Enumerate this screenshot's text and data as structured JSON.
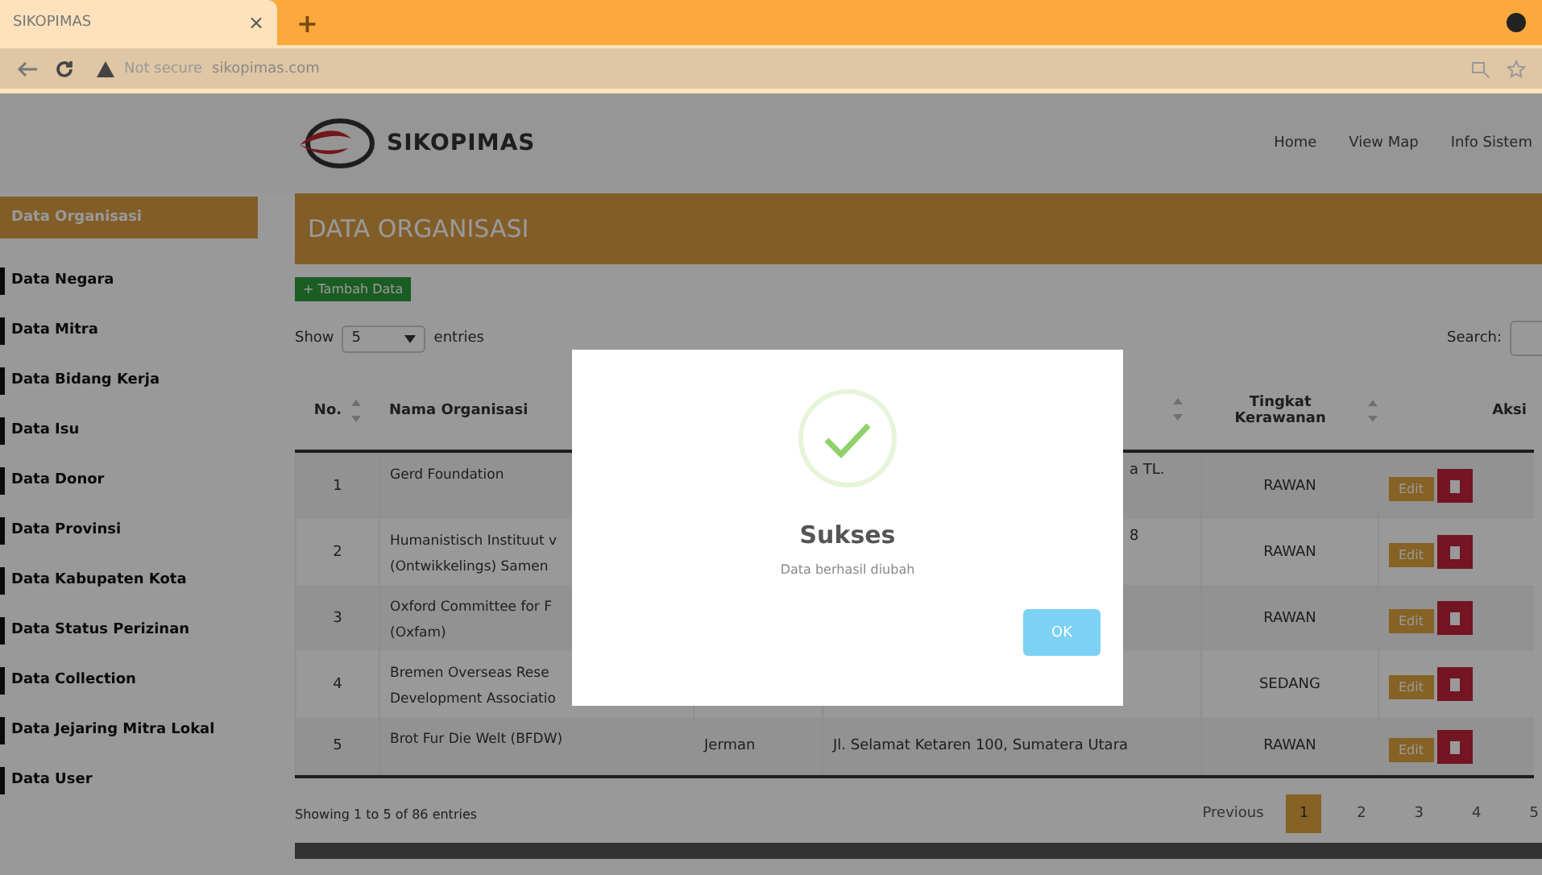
{
  "browser": {
    "tab_title": "SIKOPIMAS",
    "tab_close": "×",
    "new_tab": "+",
    "security": "Not secure",
    "url": "sikopimas.com"
  },
  "header": {
    "logo_text": "SIKOPIMAS",
    "nav": [
      "Home",
      "View Map",
      "Info Sistem"
    ]
  },
  "sidebar": {
    "items": [
      {
        "label": "Data Organisasi",
        "selected": true
      },
      {
        "label": "Data Negara",
        "selected": false
      },
      {
        "label": "Data Mitra",
        "selected": false
      },
      {
        "label": "Data Bidang Kerja",
        "selected": false
      },
      {
        "label": "Data Isu",
        "selected": false
      },
      {
        "label": "Data Donor",
        "selected": false
      },
      {
        "label": "Data Provinsi",
        "selected": false
      },
      {
        "label": "Data Kabupaten Kota",
        "selected": false
      },
      {
        "label": "Data Status Perizinan",
        "selected": false
      },
      {
        "label": "Data Collection",
        "selected": false
      },
      {
        "label": "Data Jejaring Mitra Lokal",
        "selected": false
      },
      {
        "label": "Data User",
        "selected": false
      }
    ]
  },
  "page_title": "DATA ORGANISASI",
  "add_button": "+ Tambah Data",
  "length": {
    "show": "Show",
    "value": "5",
    "entries": "entries"
  },
  "search": {
    "label": "Search:"
  },
  "table": {
    "columns": [
      "No.",
      "Nama Organisasi",
      "Tingkat Kerawanan",
      "Aksi"
    ],
    "rows": [
      {
        "no": "1",
        "name": "Gerd Foundation",
        "country": "",
        "address": "a TL.",
        "address_cut": true,
        "level": "RAWAN",
        "edit": "Edit"
      },
      {
        "no": "2",
        "name": "Humanistisch Instituut v\n(Ontwikkelings) Samen",
        "country": "",
        "address": "8",
        "address_cut": true,
        "level": "RAWAN",
        "edit": "Edit"
      },
      {
        "no": "3",
        "name": "Oxford Committee for F\n(Oxfam)",
        "country": "",
        "address": "",
        "address_cut": true,
        "level": "RAWAN",
        "edit": "Edit"
      },
      {
        "no": "4",
        "name": "Bremen Overseas Rese\nDevelopment Associatio",
        "country": "",
        "address": "",
        "address_cut": true,
        "level": "SEDANG",
        "edit": "Edit"
      },
      {
        "no": "5",
        "name": "Brot Fur Die Welt (BFDW)",
        "country": "Jerman",
        "address": "Jl. Selamat Ketaren 100, Sumatera Utara",
        "address_cut": false,
        "level": "RAWAN",
        "edit": "Edit"
      }
    ]
  },
  "info": "Showing 1 to 5 of 86 entries",
  "pagination": {
    "previous": "Previous",
    "pages": [
      {
        "label": "1",
        "selected": true
      },
      {
        "label": "2",
        "selected": false
      },
      {
        "label": "3",
        "selected": false
      },
      {
        "label": "4",
        "selected": false
      },
      {
        "label": "5",
        "selected": false
      }
    ]
  },
  "dialog": {
    "title": "Sukses",
    "message": "Data berhasil diubah",
    "ok": "OK"
  }
}
